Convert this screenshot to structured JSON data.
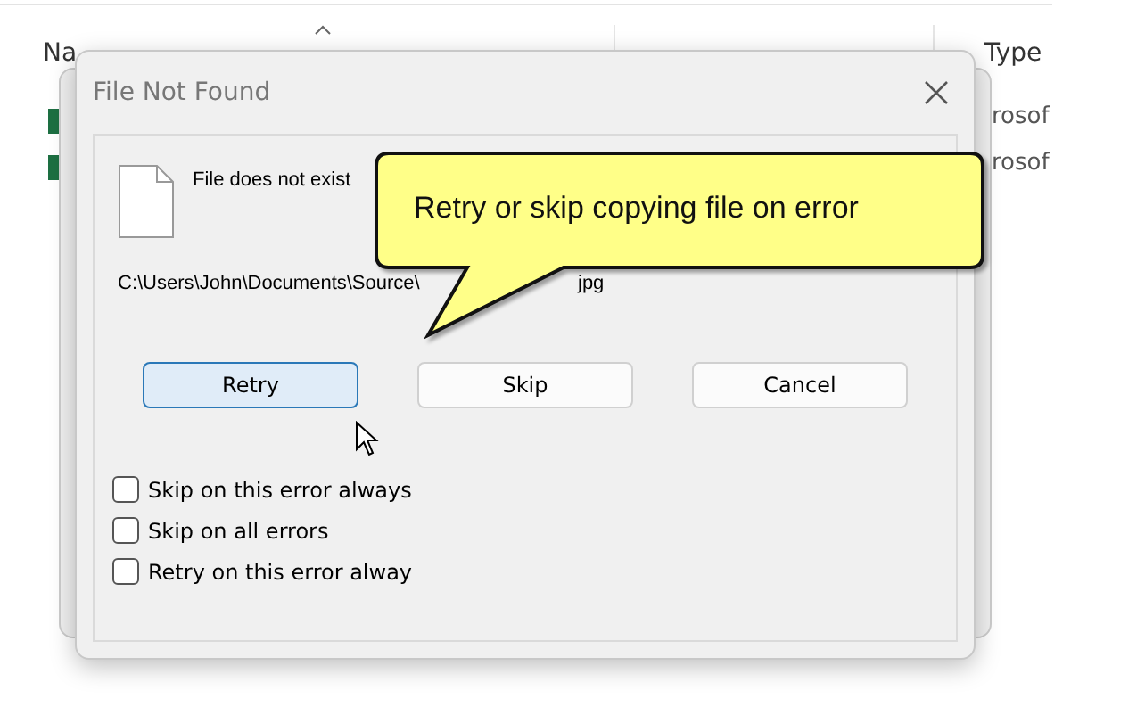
{
  "explorer": {
    "columns": [
      {
        "label": "Na",
        "sorted": true
      },
      {
        "label": "Type",
        "sorted": false
      }
    ],
    "rows": [
      {
        "type": "rosof"
      },
      {
        "type": "rosof"
      }
    ]
  },
  "dialog": {
    "title": "File Not Found",
    "message": "File does not exist",
    "path": "C:\\Users\\John\\Documents\\Source\\",
    "path_end": "jpg",
    "buttons": [
      {
        "label": "Retry",
        "selected": true
      },
      {
        "label": "Skip",
        "selected": false
      },
      {
        "label": "Cancel",
        "selected": false
      }
    ],
    "options": [
      {
        "label": "Skip on this error always",
        "checked": false
      },
      {
        "label": "Skip on all errors",
        "checked": false
      },
      {
        "label": "Retry on this error alway",
        "checked": false
      }
    ]
  },
  "callout": {
    "text": "Retry or skip copying file on error"
  }
}
